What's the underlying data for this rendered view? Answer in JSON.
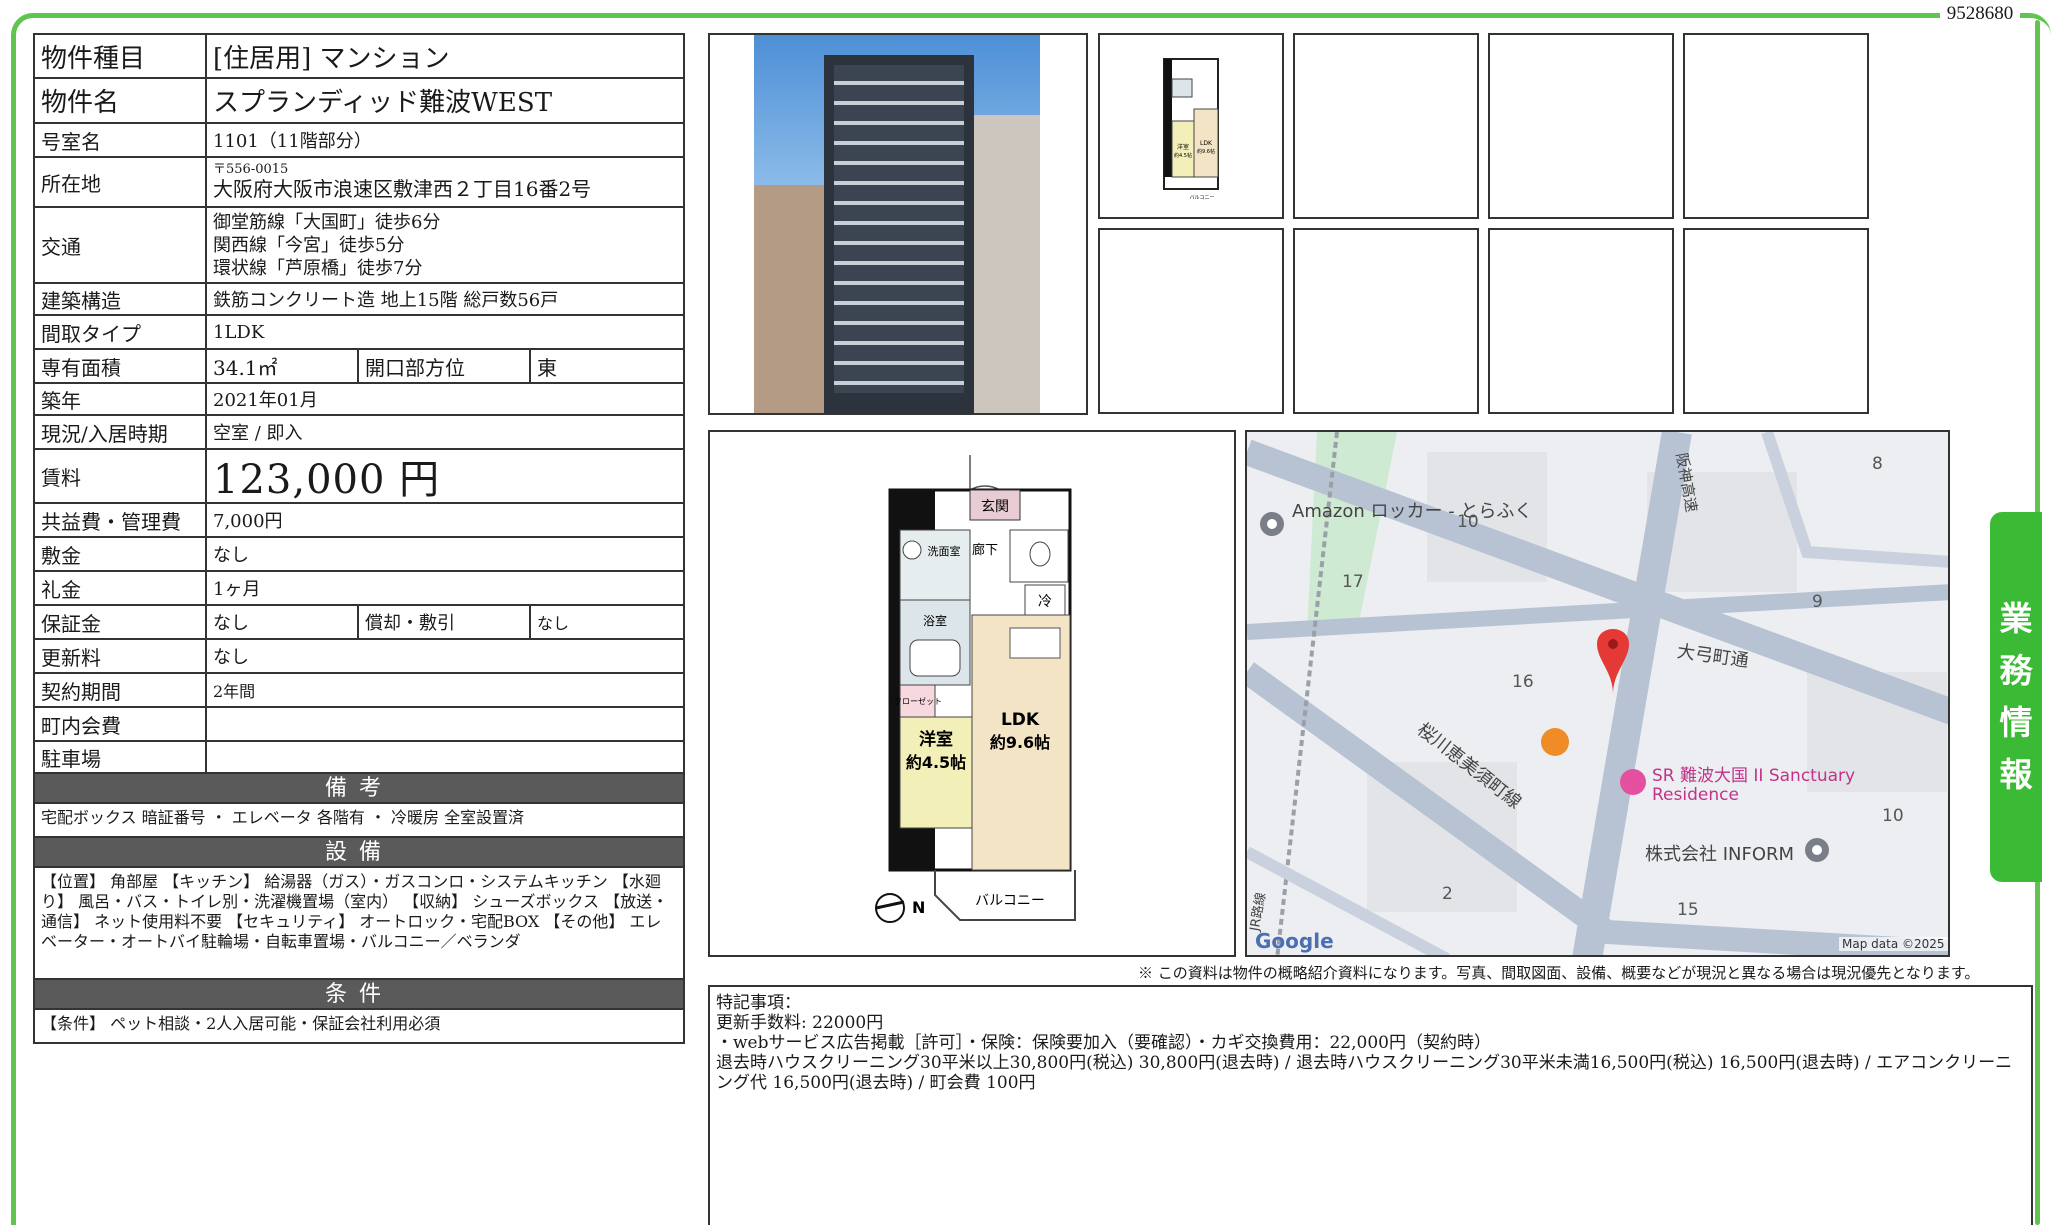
{
  "doc_id": "9528680",
  "side_tab": [
    "業",
    "務",
    "情",
    "報"
  ],
  "spec": {
    "type_label": "物件種目",
    "type_value": "[住居用] マンション",
    "name_label": "物件名",
    "name_value": "スプランディッド難波WEST",
    "room_label": "号室名",
    "room_value": "1101（11階部分）",
    "addr_label": "所在地",
    "addr_zip": "〒556-0015",
    "addr_value": "大阪府大阪市浪速区敷津西２丁目16番2号",
    "access_label": "交通",
    "access": [
      "御堂筋線「大国町」徒歩6分",
      "関西線「今宮」徒歩5分",
      "環状線「芦原橋」徒歩7分"
    ],
    "struct_label": "建築構造",
    "struct_value": "鉄筋コンクリート造 地上15階 総戸数56戸",
    "layout_label": "間取タイプ",
    "layout_value": "1LDK",
    "area_label": "専有面積",
    "area_value": "34.1㎡",
    "facing_label": "開口部方位",
    "facing_value": "東",
    "built_label": "築年",
    "built_value": "2021年01月",
    "status_label": "現況/入居時期",
    "status_value": "空室 / 即入",
    "rent_label": "賃料",
    "rent_value": "123,000 円",
    "fee_label": "共益費・管理費",
    "fee_value": "7,000円",
    "deposit_label": "敷金",
    "deposit_value": "なし",
    "key_label": "礼金",
    "key_value": "1ヶ月",
    "guarantee_label": "保証金",
    "guarantee_value": "なし",
    "amort_label": "償却・敷引",
    "amort_value": "なし",
    "renew_label": "更新料",
    "renew_value": "なし",
    "term_label": "契約期間",
    "term_value": "2年間",
    "town_label": "町内会費",
    "town_value": "",
    "parking_label": "駐車場",
    "parking_value": ""
  },
  "notes": {
    "bikou_title": "備考",
    "bikou_text": "宅配ボックス 暗証番号 ・ エレベータ 各階有 ・ 冷暖房 全室設置済",
    "setsubi_title": "設備",
    "setsubi_text": "【位置】 角部屋 【キッチン】 給湯器（ガス）・ガスコンロ・システムキッチン 【水廻り】 風呂・バス・トイレ別・洗濯機置場（室内） 【収納】 シューズボックス 【放送・通信】 ネット使用料不要 【セキュリティ】 オートロック・宅配BOX 【その他】 エレベーター・オートバイ駐輪場・自転車置場・バルコニー／ベランダ",
    "jouken_title": "条件",
    "jouken_text": "【条件】 ペット相談・2人入居可能・保証会社利用必須"
  },
  "floorplan_small": {
    "room1": "洋室",
    "room1_size": "約4.5帖",
    "room2": "LDK",
    "room2_size": "約9.6帖",
    "balcony": "バルコニー"
  },
  "floorplan": {
    "entrance": "玄関",
    "washroom": "洗面室",
    "hall": "廊下",
    "fridge": "冷",
    "bath": "浴室",
    "closet": "クローゼット",
    "room1": "洋室",
    "room1_size": "約4.5帖",
    "room2": "LDK",
    "room2_size": "約9.6帖",
    "balcony": "バルコニー",
    "north": "N"
  },
  "map": {
    "place1": "Amazon ロッカー - とらふく",
    "place2": "SR 難波大国 II Sanctuary Residence",
    "place3": "株式会社 INFORM",
    "street1": "大弓町通",
    "street2": "桜川恵美須町線",
    "street3": "阪神高速",
    "street4": "JR路線",
    "nums": [
      "8",
      "10",
      "17",
      "9",
      "16",
      "10",
      "2",
      "15"
    ],
    "google": "Google",
    "attribution": "Map data ©2025"
  },
  "disclaimer": "※ この資料は物件の概略紹介資料になります。写真、間取図面、設備、概要などが現況と異なる場合は現況優先となります。",
  "remarks": {
    "title": "特記事項：",
    "line1": "更新手数料: 22000円",
    "line2": "・webサービス広告掲載［許可］・保険：保険要加入（要確認）・カギ交換費用：22,000円（契約時）",
    "line3": "退去時ハウスクリーニング30平米以上30,800円(税込) 30,800円(退去時) / 退去時ハウスクリーニング30平米未満16,500円(税込) 16,500円(退去時) / エアコンクリーニング代 16,500円(退去時) / 町会費 100円"
  }
}
